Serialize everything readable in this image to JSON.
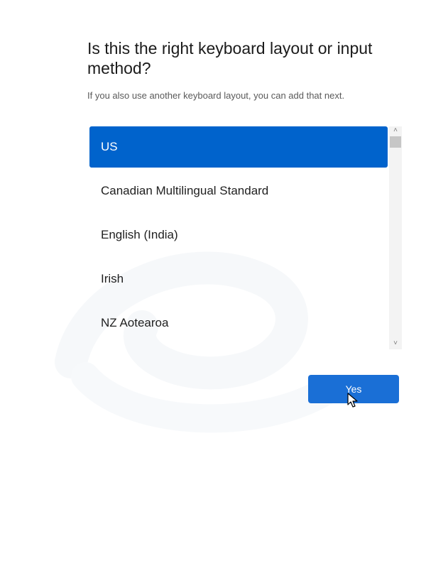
{
  "page": {
    "title": "Is this the right keyboard layout or input method?",
    "subtitle": "If you also use another keyboard layout, you can add that next."
  },
  "layouts": {
    "selected_index": 0,
    "items": [
      {
        "label": "US"
      },
      {
        "label": "Canadian Multilingual Standard"
      },
      {
        "label": "English (India)"
      },
      {
        "label": "Irish"
      },
      {
        "label": "NZ Aotearoa"
      }
    ]
  },
  "scrollbar": {
    "up_arrow": "˄",
    "down_arrow": "˅"
  },
  "actions": {
    "yes_label": "Yes"
  },
  "colors": {
    "selected_bg": "#0063cc",
    "button_bg": "#1a6fd6"
  },
  "icons": {
    "cursor": "mouse-pointer-icon"
  }
}
